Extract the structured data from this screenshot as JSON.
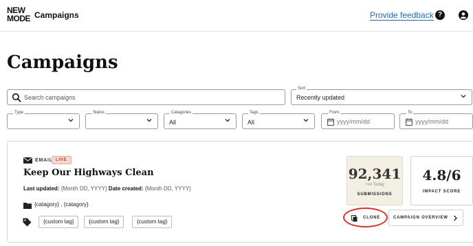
{
  "header": {
    "logo_line1": "NEW",
    "logo_line2": "MODE",
    "title": "Campaigns",
    "feedback_link": "Provide feedback",
    "help_glyph": "?"
  },
  "page": {
    "title": "Campaigns"
  },
  "search": {
    "placeholder": "Search campaigns"
  },
  "sort": {
    "label": "Sort",
    "value": "Recently updated"
  },
  "filters": {
    "type": {
      "label": "Type",
      "value": ""
    },
    "status": {
      "label": "Status",
      "value": ""
    },
    "categories": {
      "label": "Catagories",
      "value": "All"
    },
    "tags": {
      "label": "Tags",
      "value": "All"
    },
    "from": {
      "label": "From",
      "placeholder": "yyyy/mm/dd"
    },
    "to": {
      "label": "To",
      "placeholder": "yyyy/mm/dd"
    }
  },
  "campaign": {
    "type": "EMAIL",
    "status": "LIVE",
    "title": "Keep Our Highways Clean",
    "last_updated_label": "Last updated:",
    "last_updated_value": "{Month DD, YYYY}",
    "date_created_label": "Date created:",
    "date_created_value": "{Month DD, YYYY}",
    "categories": "{catagory} , {catagory}",
    "tags": [
      "{custom tag}",
      "{custom tag}",
      "{custom tag}"
    ],
    "submissions": {
      "value": "92,341",
      "today": "+## Today",
      "label": "SUBMISSIONS"
    },
    "impact": {
      "value": "4.8/6",
      "label": "IMPACT SCORE"
    },
    "clone_label": "CLONE",
    "overview_label": "CAMPAIGN OVERVIEW"
  },
  "colors": {
    "link": "#1a6bbf",
    "live_badge_bg": "#f9d6cf",
    "live_badge_text": "#c0392b",
    "submissions_bg": "#f3efe3",
    "highlight_ring": "#d93025"
  },
  "icons": {
    "help": "help-circle-icon",
    "user": "user-circle-icon",
    "search": "search-icon",
    "chevron": "chevron-down-icon",
    "calendar": "calendar-icon",
    "email": "envelope-icon",
    "folder": "folder-icon",
    "tag": "tag-icon",
    "clone": "copy-icon",
    "arrow": "chevron-right-icon"
  }
}
